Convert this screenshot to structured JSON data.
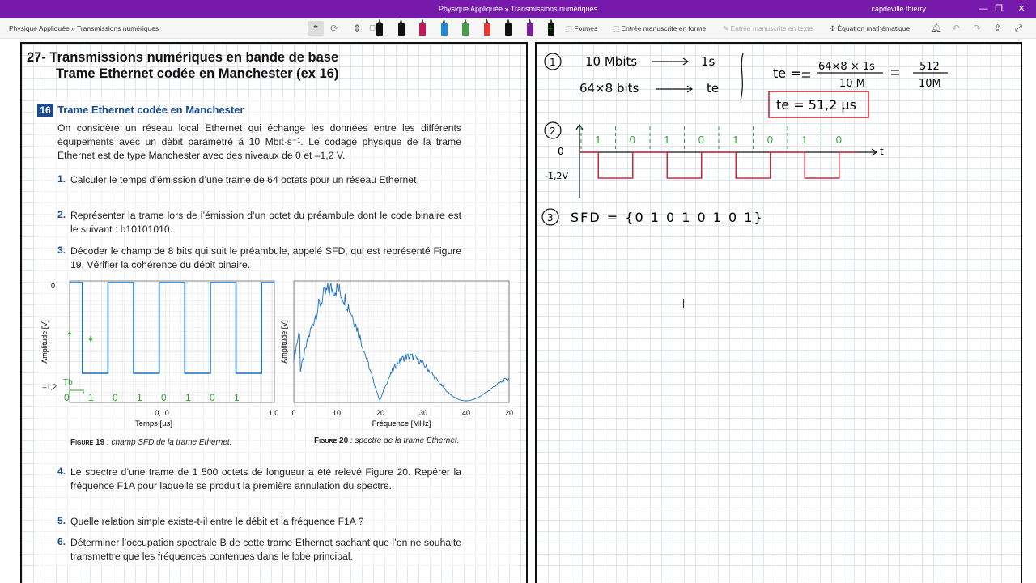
{
  "window": {
    "title": "Physique Appliquée » Transmissions numériques",
    "user": "capdeville thierry",
    "controls": [
      "—",
      "❐",
      "✕"
    ]
  },
  "toolbar": {
    "breadcrumb": "Physique Appliquée » Transmissions numériques",
    "shapes": "Formes",
    "ink_to_shape": "Entrée manuscrite en forme",
    "ink_to_text": "Entrée manuscrite en texte",
    "equation": "Équation mathématique",
    "pen_colors": [
      "#111111",
      "#111111",
      "#c2185b",
      "#1e88e5",
      "#43a047",
      "#e53935",
      "#111111",
      "#7b1fa2",
      "#111111"
    ]
  },
  "exercise": {
    "heading1": "27- Transmissions numériques en bande de base",
    "heading2": "Trame Ethernet codée en Manchester (ex 16)",
    "number": "16",
    "title": "Trame Ethernet codée en Manchester",
    "intro": "On considère un réseau local Ethernet qui échange les données entre les différents équipements avec un débit paramétré à 10 Mbit·s⁻¹. Le codage physique de la trame Ethernet est de type Manchester avec des niveaux de 0 et –1,2 V.",
    "questions": [
      {
        "n": "1.",
        "text": "Calculer le temps d’émission d’une trame de 64 octets pour un réseau Ethernet."
      },
      {
        "n": "2.",
        "text": "Représenter la trame lors de l’émission d’un octet du préambule dont le code binaire est le suivant : b10101010."
      },
      {
        "n": "3.",
        "text": "Décoder le champ de 8 bits qui suit le préambule, appelé SFD, qui est représenté Figure 19. Vérifier la cohérence du débit binaire."
      },
      {
        "n": "4.",
        "text": "Le spectre d’une trame de 1 500 octets de longueur a été relevé Figure 20. Repérer la fréquence F1A pour laquelle se produit la première annulation du spectre."
      },
      {
        "n": "5.",
        "text": "Quelle relation simple existe-t-il entre le débit et la fréquence F1A ?"
      },
      {
        "n": "6.",
        "text": "Déterminer l’occupation spectrale B de cette trame Ethernet sachant que l’on ne souhaite transmettre que les fréquences contenues dans le lobe principal."
      }
    ],
    "fig19": {
      "caption_label": "Figure 19",
      "caption_text": " : champ SFD de la trame Ethernet.",
      "ylabel": "Amplitude [V]",
      "xlabel": "Temps [µs]",
      "y_ticks": [
        "0",
        "–1,2"
      ],
      "x_ticks": [
        "0,10",
        "1,0"
      ],
      "annotation_tb": "Tb",
      "annotation_bits": "0 1 0 1 0 1 0 1"
    },
    "fig20": {
      "caption_label": "Figure 20",
      "caption_text": " : spectre de la trame Ethernet.",
      "ylabel": "Amplitude [V]",
      "xlabel": "Fréquence [MHz]",
      "x_ticks": [
        "0",
        "10",
        "20",
        "30",
        "40",
        "20"
      ]
    }
  },
  "notes": {
    "q1": {
      "num": "1",
      "l1a": "10 Mbits",
      "l1b": "1s",
      "l2a": "64×8 bits",
      "l2b": "te",
      "eq_lhs": "te =",
      "frac1_num": "64×8 × 1s",
      "frac1_den": "10 M",
      "eq2": "=",
      "frac2_num": "512",
      "frac2_den": "10M",
      "result": "te = 51,2 µs"
    },
    "q2": {
      "num": "2",
      "bits": [
        "1",
        "0",
        "1",
        "0",
        "1",
        "0",
        "1",
        "0"
      ],
      "level0": "0",
      "level1": "-1,2V",
      "axis": "t"
    },
    "q3": {
      "num": "3",
      "text": "SFD = {0 1 0 1 0 1 0 1}"
    }
  },
  "chart_data": [
    {
      "type": "line",
      "title": "",
      "xlabel": "Temps [µs]",
      "ylabel": "Amplitude [V]",
      "y_levels": [
        0,
        -1.2
      ],
      "note": "Manchester SFD waveform, 8 bits 0 1 0 1 0 1 0 1",
      "bits": [
        0,
        1,
        0,
        1,
        0,
        1,
        0,
        1
      ]
    },
    {
      "type": "line",
      "title": "",
      "xlabel": "Fréquence [MHz]",
      "ylabel": "Amplitude [V]",
      "xlim": [
        0,
        20
      ],
      "x_tick_labels": [
        "0",
        "10",
        "20",
        "30",
        "40",
        "20"
      ],
      "lobes": [
        {
          "peak_at_tick": "10",
          "zero_at_tick": "20"
        },
        {
          "peak_at_tick": "30",
          "zero_at_tick": "40"
        }
      ]
    }
  ]
}
